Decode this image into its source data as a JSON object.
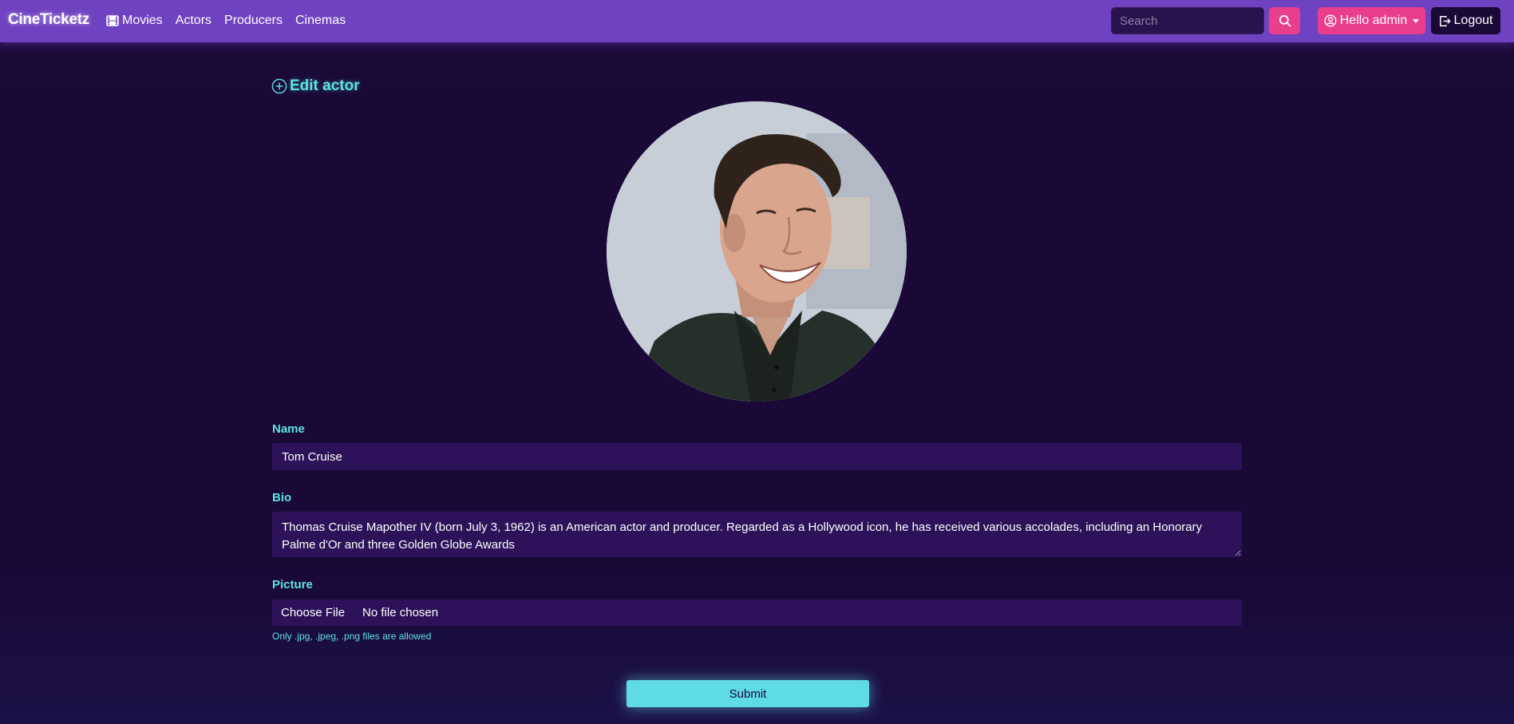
{
  "navbar": {
    "brand": "CineTicketz",
    "links": [
      {
        "label": "Movies",
        "icon": "film-icon"
      },
      {
        "label": "Actors"
      },
      {
        "label": "Producers"
      },
      {
        "label": "Cinemas"
      }
    ],
    "search_placeholder": "Search",
    "search_icon": "search-icon",
    "user_label": "Hello admin",
    "user_icon": "user-circle-icon",
    "logout_label": "Logout",
    "logout_icon": "logout-icon"
  },
  "page": {
    "title": "Edit actor",
    "title_icon": "plus-circle-icon",
    "avatar_alt": "Tom Cruise"
  },
  "form": {
    "name_label": "Name",
    "name_value": "Tom Cruise",
    "bio_label": "Bio",
    "bio_value": "Thomas Cruise Mapother IV (born July 3, 1962) is an American actor and producer. Regarded as a Hollywood icon, he has received various accolades, including an Honorary Palme d'Or and three Golden Globe Awards",
    "picture_label": "Picture",
    "choose_file_label": "Choose File",
    "file_status": "No file chosen",
    "file_hint": "Only .jpg, .jpeg, .png files are allowed",
    "submit_label": "Submit"
  },
  "colors": {
    "navbar": "#6f42c1",
    "accent_pink": "#e83e8c",
    "accent_cyan": "#5ee3e6",
    "background": "#1a0836",
    "field": "#2d1259"
  }
}
